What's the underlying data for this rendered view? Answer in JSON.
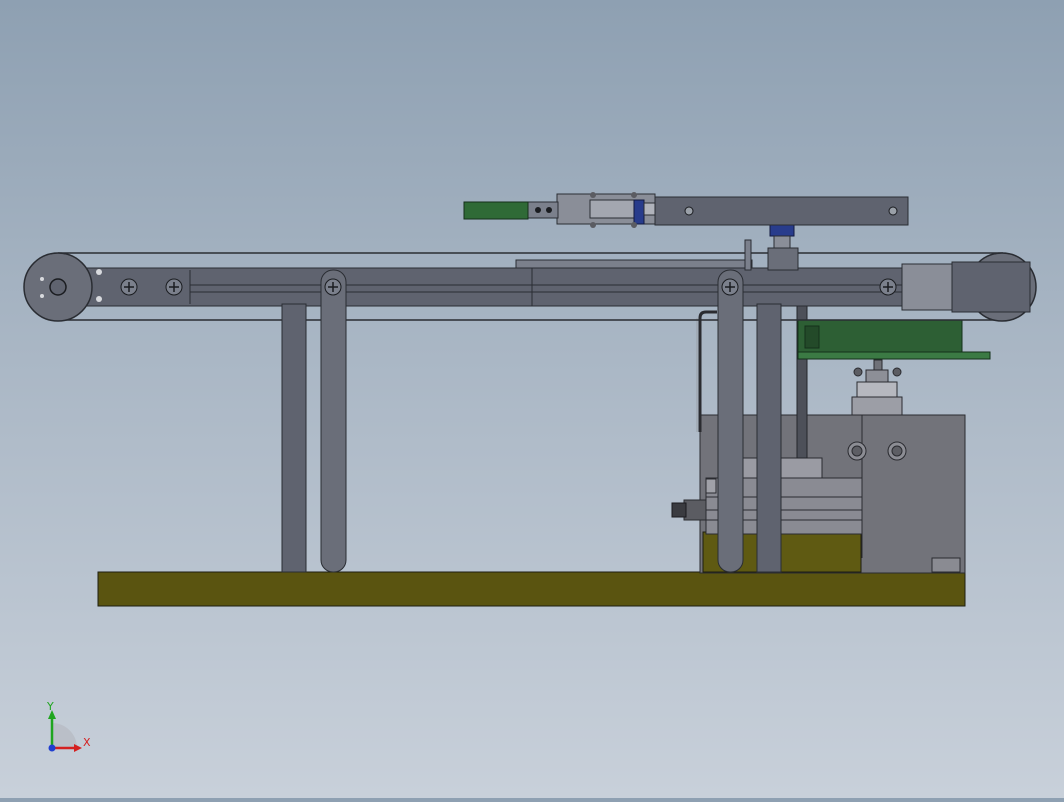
{
  "viewport": {
    "background_top": "#8ea0b2",
    "background_bottom": "#c8d0da"
  },
  "model": {
    "colors": {
      "frame": "#5f636f",
      "frame_dark": "#3e424c",
      "frame_light": "#7b808c",
      "base_plate": "#5a5410",
      "gripper_pad": "#2f6a36",
      "circuit_board": "#2d5f34",
      "motor_block": "#72737a",
      "yellow_block": "#5f5a12",
      "blue_mount": "#283c8c",
      "belt_line": "#2a2d33"
    }
  },
  "triad": {
    "x_label": "X",
    "y_label": "Y",
    "x_color": "#d42020",
    "y_color": "#1fa51f",
    "z_color": "#1f3fd0"
  }
}
